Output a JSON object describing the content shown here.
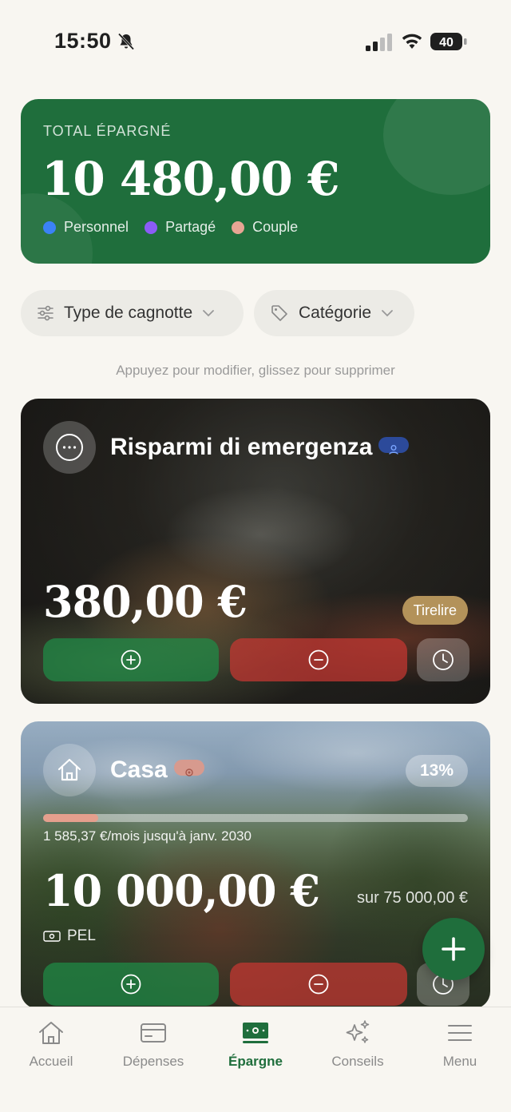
{
  "status_bar": {
    "time": "15:50",
    "battery": "40"
  },
  "summary": {
    "label": "TOTAL ÉPARGNÉ",
    "amount": "10 480,00 €",
    "legend": [
      {
        "label": "Personnel",
        "color": "#3b82f6"
      },
      {
        "label": "Partagé",
        "color": "#8b5cf6"
      },
      {
        "label": "Couple",
        "color": "#e8a594"
      }
    ]
  },
  "filters": {
    "type_label": "Type de cagnotte",
    "category_label": "Catégorie"
  },
  "hint": "Appuyez pour modifier, glissez pour supprimer",
  "savings": [
    {
      "title": "Risparmi di emergenza",
      "amount": "380,00 €",
      "badge": "Tirelire",
      "icon": "more-icon",
      "owner_type": "personnel"
    },
    {
      "title": "Casa",
      "amount": "10 000,00 €",
      "percent": "13%",
      "progress": 0.13,
      "monthly": "1 585,37 €/mois jusqu'à janv. 2030",
      "target": "sur 75 000,00 €",
      "account": "PEL",
      "icon": "home-icon",
      "owner_type": "couple"
    }
  ],
  "tabs": [
    {
      "label": "Accueil",
      "icon": "home-icon"
    },
    {
      "label": "Dépenses",
      "icon": "card-icon"
    },
    {
      "label": "Épargne",
      "icon": "banknote-icon",
      "active": true
    },
    {
      "label": "Conseils",
      "icon": "sparkles-icon"
    },
    {
      "label": "Menu",
      "icon": "menu-icon"
    }
  ],
  "colors": {
    "brand_green": "#1f6e3c",
    "add_green": "#1e8c46",
    "remove_red": "#c83732",
    "tirelire_gold": "#b3925a"
  }
}
